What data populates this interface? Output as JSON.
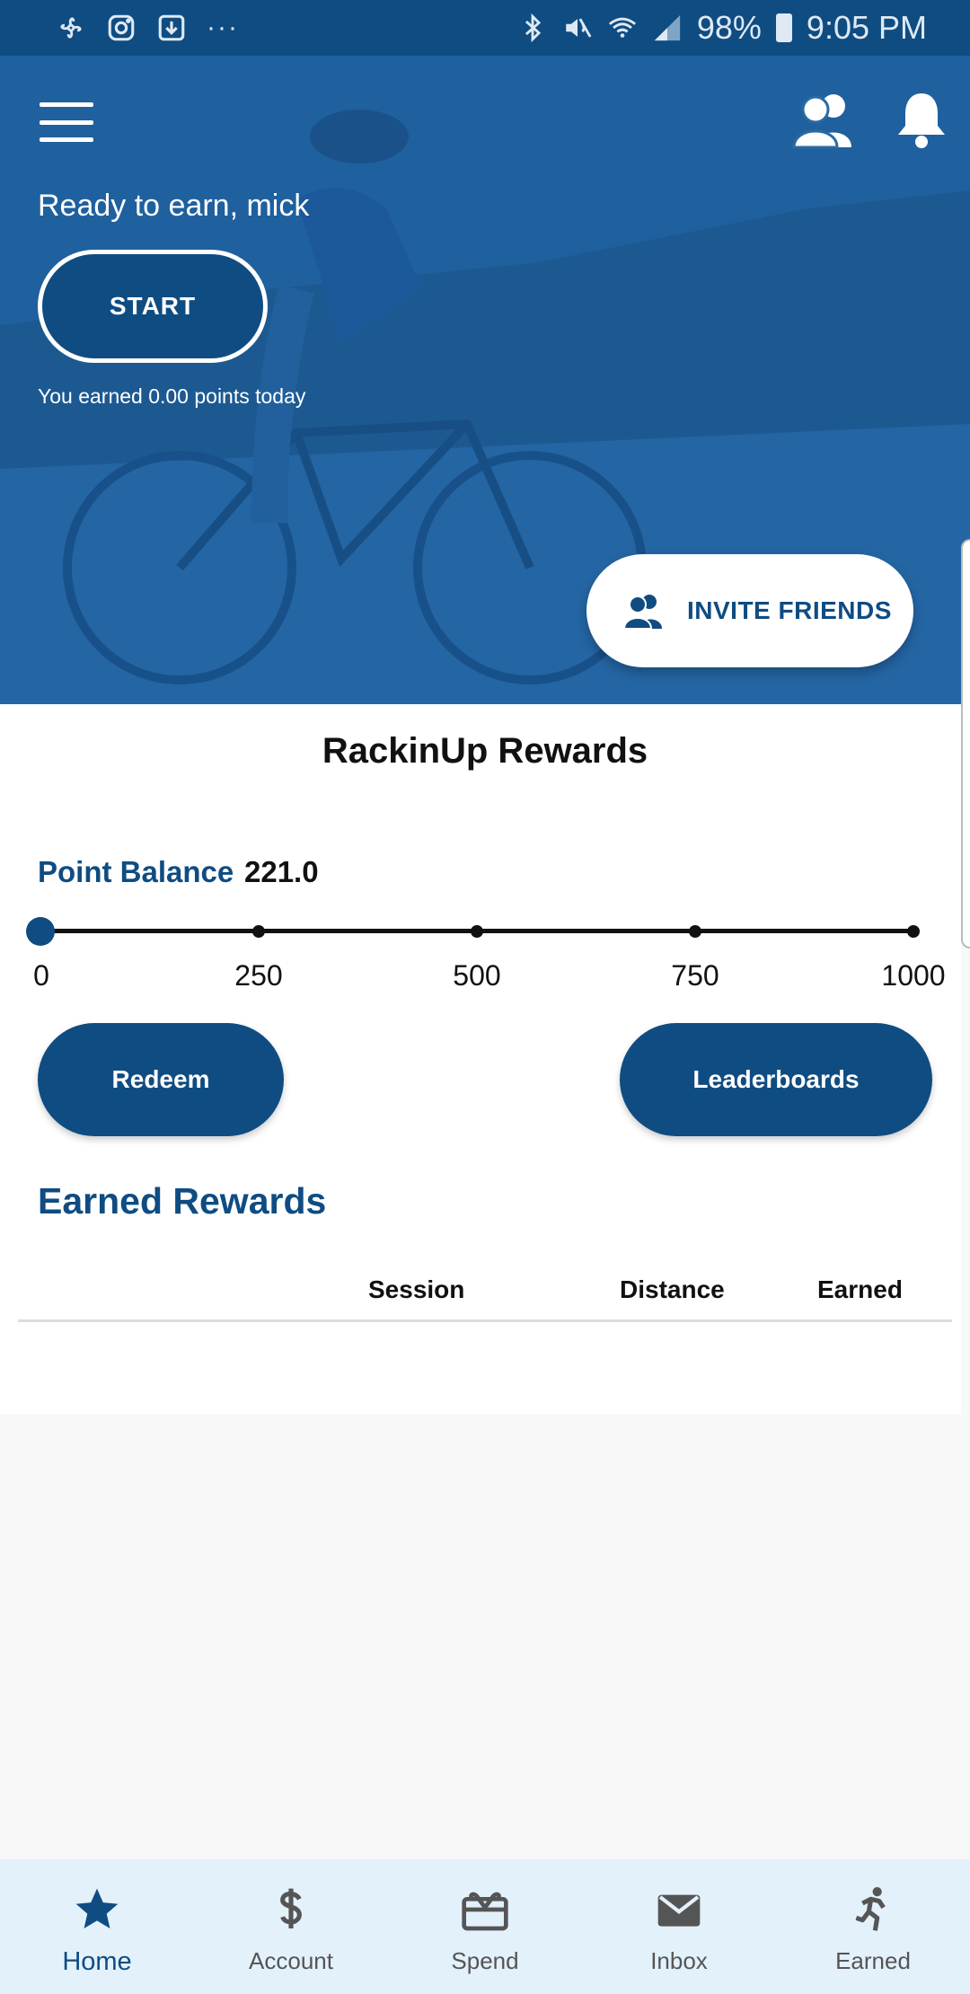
{
  "status_bar": {
    "battery": "98%",
    "time": "9:05 PM",
    "more": "···"
  },
  "hero": {
    "greeting": "Ready to earn, mick",
    "start_label": "START",
    "earned_today": "You earned 0.00 points today",
    "invite_label": "INVITE FRIENDS"
  },
  "rewards": {
    "title": "RackinUp Rewards",
    "point_balance_label": "Point Balance",
    "point_balance_value": "221.0",
    "scale_ticks": [
      "0",
      "250",
      "500",
      "750",
      "1000"
    ],
    "redeem_label": "Redeem",
    "leaderboards_label": "Leaderboards",
    "earned_title": "Earned Rewards",
    "table_headers": [
      "Session",
      "Distance",
      "Earned"
    ]
  },
  "nav": {
    "items": [
      {
        "label": "Home",
        "icon": "star-icon"
      },
      {
        "label": "Account",
        "icon": "dollar-icon"
      },
      {
        "label": "Spend",
        "icon": "gift-card-icon"
      },
      {
        "label": "Inbox",
        "icon": "mail-icon"
      },
      {
        "label": "Earned",
        "icon": "runner-icon"
      }
    ],
    "active": "Home"
  },
  "colors": {
    "primary": "#0f4c82",
    "nav_bg": "#e3f1fb"
  }
}
